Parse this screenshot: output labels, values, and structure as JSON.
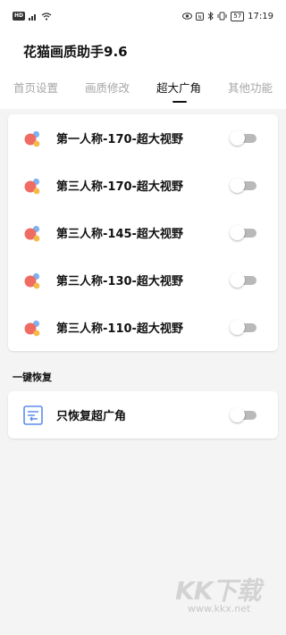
{
  "status_bar": {
    "network": "HD",
    "battery": "57",
    "time": "17:19"
  },
  "app": {
    "title": "花猫画质助手9.6"
  },
  "tabs": [
    {
      "label": "首页设置",
      "active": false
    },
    {
      "label": "画质修改",
      "active": false
    },
    {
      "label": "超大广角",
      "active": true
    },
    {
      "label": "其他功能",
      "active": false
    }
  ],
  "options": [
    {
      "label": "第一人称-170-超大视野",
      "enabled": false
    },
    {
      "label": "第三人称-170-超大视野",
      "enabled": false
    },
    {
      "label": "第三人称-145-超大视野",
      "enabled": false
    },
    {
      "label": "第三人称-130-超大视野",
      "enabled": false
    },
    {
      "label": "第三人称-110-超大视野",
      "enabled": false
    }
  ],
  "restore_section": {
    "title": "一键恢复",
    "item": {
      "label": "只恢复超广角",
      "enabled": false
    }
  },
  "watermark": {
    "logo": "KK下载",
    "url": "www.kkx.net"
  },
  "colors": {
    "accent_red": "#ef6c63",
    "accent_blue": "#7fb2f0",
    "accent_yellow": "#f4ba47",
    "toggle_off": "#b9b9b9"
  }
}
